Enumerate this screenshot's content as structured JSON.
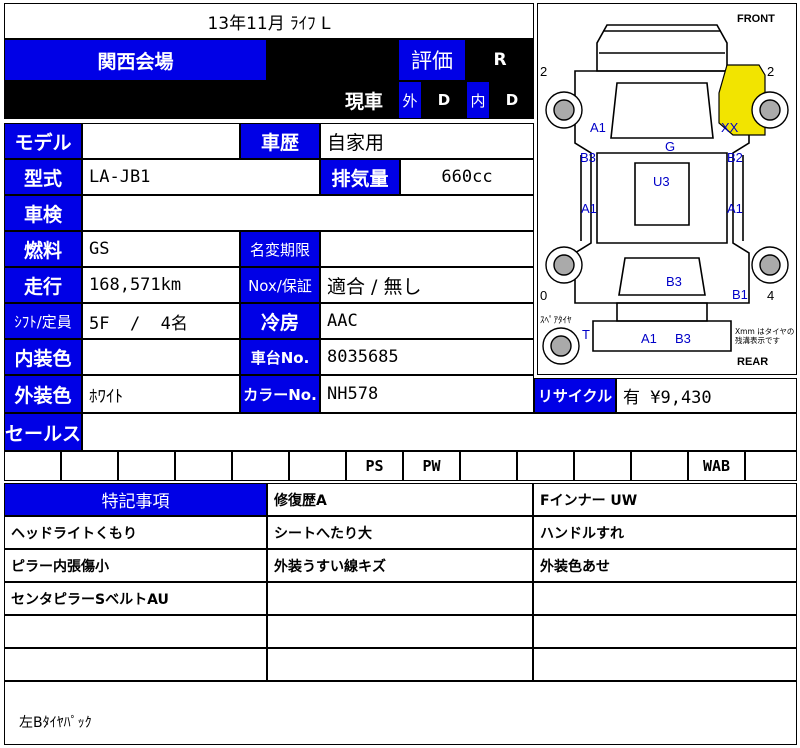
{
  "header": {
    "title": "13年11月 ﾗｲﾌ L",
    "venue": "関西会場",
    "hyoka_label": "評価",
    "hyoka_value": "R",
    "gensha": "現車",
    "outer_label": "外",
    "outer_value": "D",
    "inner_label": "内",
    "inner_value": "D"
  },
  "fields": {
    "model_label": "モデル",
    "model_value": "",
    "history_label": "車歴",
    "history_value": "自家用",
    "type_label": "型式",
    "type_value": "LA-JB1",
    "disp_label": "排気量",
    "disp_value": "660cc",
    "inspection_label": "車検",
    "inspection_value": "",
    "fuel_label": "燃料",
    "fuel_value": "GS",
    "namechange_label": "名変期限",
    "namechange_value": "",
    "mileage_label": "走行",
    "mileage_value": "168,571km",
    "nox_label": "Nox/保証",
    "nox_value": "適合 / 無し",
    "shift_label": "ｼﾌﾄ/定員",
    "shift_value": "5F  /  4名",
    "ac_label": "冷房",
    "ac_value": "AAC",
    "interior_label": "内装色",
    "interior_value": "",
    "chassis_label": "車台No.",
    "chassis_value": "8035685",
    "exterior_label": "外装色",
    "exterior_value": "ﾎﾜｲﾄ",
    "colorno_label": "カラーNo.",
    "colorno_value": "NH578",
    "recycle_label": "リサイクル",
    "recycle_value": "有 ¥9,430",
    "sales_label": "セールス",
    "sales_value": ""
  },
  "equipment": [
    "",
    "",
    "",
    "",
    "",
    "",
    "PS",
    "PW",
    "",
    "",
    "",
    "",
    "WAB",
    ""
  ],
  "notes": {
    "title": "特記事項",
    "rows": [
      [
        "",
        "修復歴A",
        "Fインナー UW"
      ],
      [
        "ヘッドライトくもり",
        "シートへたり大",
        "ハンドルすれ"
      ],
      [
        "ピラー内張傷小",
        "外装うすい線キズ",
        "外装色あせ"
      ],
      [
        "センタピラーSベルトAU",
        "",
        ""
      ],
      [
        "",
        "",
        ""
      ],
      [
        "",
        "",
        ""
      ]
    ],
    "footer": "左Bﾀｲﾔﾊﾟｯｸ"
  },
  "diagram": {
    "front": "FRONT",
    "rear": "REAR",
    "spare": "ｽﾍﾟｱﾀｲﾔ",
    "spare_mark": "T",
    "note": "Xmm はタイヤの\n残溝表示です",
    "tire_fl": "2",
    "tire_fr": "2",
    "tire_rl": "0",
    "tire_rr": "4",
    "marks": {
      "a1_fl": "A1",
      "xx": "XX",
      "g": "G",
      "b3_l": "B3",
      "b2_r": "B2",
      "u3": "U3",
      "a1_l": "A1",
      "a1_r": "A1",
      "b3_rear": "B3",
      "b1": "B1",
      "a1_bumper": "A1",
      "b3_bumper": "B3"
    },
    "highlight_color": "#f2e400",
    "mark_color": "#0000c8"
  }
}
